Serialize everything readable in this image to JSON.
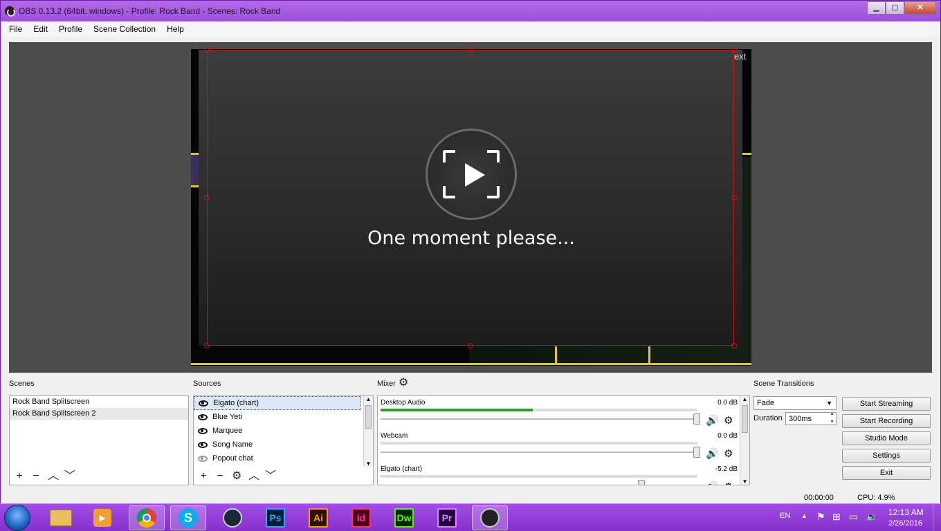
{
  "window": {
    "title": "OBS 0.13.2 (64bit, windows) - Profile: Rock Band - Scenes: Rock Band",
    "controls": {
      "minimize": "▭",
      "maximize": "▢",
      "close": "✕"
    }
  },
  "menu": [
    "File",
    "Edit",
    "Profile",
    "Scene Collection",
    "Help"
  ],
  "preview": {
    "message": "One moment please...",
    "overflow_text": "ext"
  },
  "scenes": {
    "label": "Scenes",
    "items": [
      "Rock Band Splitscreen",
      "Rock Band Splitscreen 2"
    ]
  },
  "sources": {
    "label": "Sources",
    "items": [
      {
        "name": "Elgato (chart)",
        "visible": true
      },
      {
        "name": "Blue Yeti",
        "visible": true
      },
      {
        "name": "Marquee",
        "visible": true
      },
      {
        "name": "Song Name",
        "visible": true
      },
      {
        "name": "Popout chat",
        "visible": false
      }
    ]
  },
  "mixer": {
    "label": "Mixer",
    "channels": [
      {
        "name": "Desktop Audio",
        "db": "0.0 dB",
        "level": 0.48,
        "volume": 1.0
      },
      {
        "name": "Webcam",
        "db": "0.0 dB",
        "level": 0.0,
        "volume": 1.0
      },
      {
        "name": "Elgato (chart)",
        "db": "-5.2 dB",
        "level": 0.0,
        "volume": 0.82
      }
    ]
  },
  "transitions": {
    "label": "Scene Transitions",
    "selected": "Fade",
    "duration_label": "Duration",
    "duration_value": "300ms"
  },
  "controls": {
    "start_streaming": "Start Streaming",
    "start_recording": "Start Recording",
    "studio_mode": "Studio Mode",
    "settings": "Settings",
    "exit": "Exit"
  },
  "status": {
    "time": "00:00:00",
    "cpu": "CPU: 4.9%"
  },
  "taskbar": {
    "apps": [
      "explorer",
      "media-player",
      "chrome",
      "skype",
      "steam",
      "Ps",
      "Ai",
      "Id",
      "Dw",
      "Pr",
      "obs"
    ],
    "lang": "EN",
    "clock_time": "12:13 AM",
    "clock_date": "2/26/2016"
  }
}
